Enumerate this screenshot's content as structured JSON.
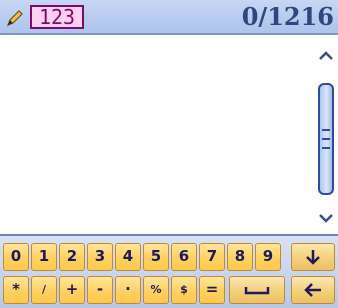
{
  "header": {
    "mode_label": "123",
    "char_count": "0/1216",
    "edit_icon": "pencil-icon"
  },
  "scrollbar": {
    "up_icon": "chevron-up-icon",
    "down_icon": "chevron-down-icon"
  },
  "keyboard": {
    "row1": [
      "0",
      "1",
      "2",
      "3",
      "4",
      "5",
      "6",
      "7",
      "8",
      "9"
    ],
    "row2": [
      "*",
      "/",
      "+",
      "-",
      "·",
      "%",
      "$",
      "="
    ],
    "special_keys": {
      "down_arrow": "arrow-down-icon",
      "space": "space-icon",
      "backspace": "arrow-left-icon"
    },
    "colors": {
      "key_fill": "#ffd061",
      "key_text": "#1e1a5e"
    }
  },
  "theme": {
    "header_bg": "#b8ccef",
    "accent": "#2f4c9c",
    "mode_badge_bg": "#ffd0f0",
    "mode_badge_text": "#7a0e67"
  }
}
